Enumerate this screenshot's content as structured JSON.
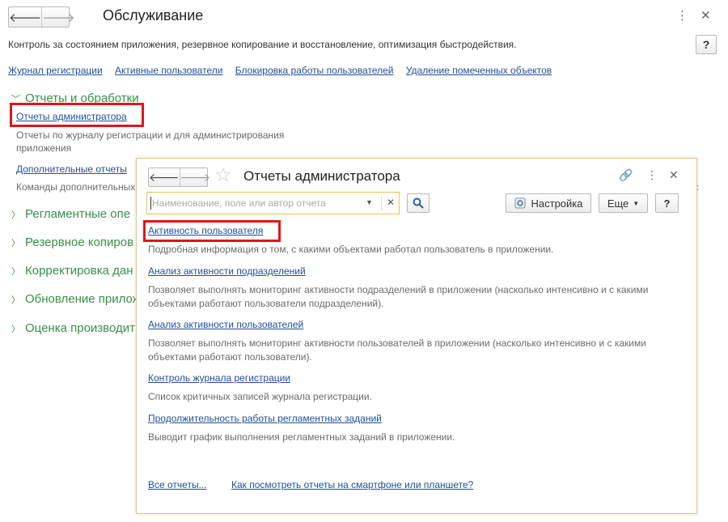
{
  "main": {
    "title": "Обслуживание",
    "description": "Контроль за состоянием приложения, резервное копирование и восстановление, оптимизация быстродействия.",
    "help_label": "?",
    "links": [
      "Журнал регистрации",
      "Активные пользователи",
      "Блокировка работы пользователей",
      "Удаление помеченных объектов"
    ],
    "groups": [
      {
        "label": "Отчеты и обработки",
        "expanded": true
      },
      {
        "label": "Регламентные опе",
        "expanded": false
      },
      {
        "label": "Резервное копиров",
        "expanded": false
      },
      {
        "label": "Корректировка дан",
        "expanded": false
      },
      {
        "label": "Обновление прилож",
        "expanded": false
      },
      {
        "label": "Оценка производит",
        "expanded": false
      }
    ],
    "reports_link": "Отчеты администратора",
    "reports_desc": "Отчеты по журналу регистрации и для администрирования приложения",
    "extra_link": "Дополнительные отчеты",
    "extra_desc": "Команды дополнительных"
  },
  "popup": {
    "title": "Отчеты администратора",
    "search_placeholder": "Наименование, поле или автор отчета",
    "settings_label": "Настройка",
    "more_label": "Еще",
    "help_label": "?",
    "reports": [
      {
        "title": "Активность пользователя",
        "desc": "Подробная информация о том, с какими объектами работал пользователь в приложении."
      },
      {
        "title": "Анализ активности подразделений",
        "desc": "Позволяет выполнять мониторинг активности подразделений в приложении (насколько интенсивно и с какими объектами работают пользователи подразделений)."
      },
      {
        "title": "Анализ активности пользователей",
        "desc": "Позволяет выполнять мониторинг активности пользователей в приложении (насколько интенсивно и с какими объектами работают пользователи)."
      },
      {
        "title": "Контроль журнала регистрации",
        "desc": "Список критичных записей журнала регистрации."
      },
      {
        "title": "Продолжительность работы регламентных заданий",
        "desc": "Выводит график выполнения регламентных заданий в приложении."
      }
    ],
    "all_reports_link": "Все отчеты...",
    "mobile_link": "Как посмотреть отчеты на смартфоне или планшете?"
  },
  "colors": {
    "accent_green": "#3a8f46",
    "link_blue": "#1f4f9a",
    "highlight_red": "#e0151b",
    "popup_border": "#e7c87a"
  },
  "icons": [
    "back-arrow-icon",
    "forward-arrow-icon",
    "more-vertical-icon",
    "close-icon",
    "star-icon",
    "link-icon",
    "search-icon",
    "settings-icon",
    "chevron-down-icon",
    "chevron-right-icon"
  ]
}
